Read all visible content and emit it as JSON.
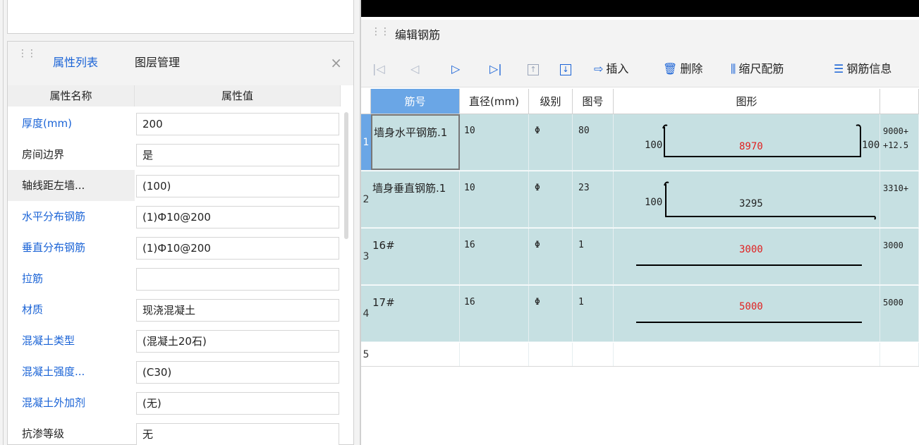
{
  "left_panel": {
    "tabs": [
      "属性列表",
      "图层管理"
    ],
    "close": "×",
    "columns": [
      "属性名称",
      "属性值"
    ],
    "rows": [
      {
        "name": "厚度(mm)",
        "value": "200",
        "blue": true
      },
      {
        "name": "房间边界",
        "value": "是",
        "blue": false
      },
      {
        "name": "轴线距左墙...",
        "value": "(100)",
        "blue": false
      },
      {
        "name": "水平分布钢筋",
        "value": "(1)Ф10@200",
        "blue": true
      },
      {
        "name": "垂直分布钢筋",
        "value": "(1)Ф10@200",
        "blue": true
      },
      {
        "name": "拉筋",
        "value": "",
        "blue": true
      },
      {
        "name": "材质",
        "value": "现浇混凝土",
        "blue": true
      },
      {
        "name": "混凝土类型",
        "value": "(混凝土20石)",
        "blue": true
      },
      {
        "name": "混凝土强度...",
        "value": "(C30)",
        "blue": true
      },
      {
        "name": "混凝土外加剂",
        "value": "(无)",
        "blue": true
      },
      {
        "name": "抗渗等级",
        "value": "无",
        "blue": false
      }
    ]
  },
  "right_panel": {
    "title": "编辑钢筋",
    "toolbar": {
      "insert": "插入",
      "delete": "删除",
      "scale": "缩尺配筋",
      "info": "钢筋信息"
    },
    "columns": [
      "筋号",
      "直径(mm)",
      "级别",
      "图号",
      "图形"
    ],
    "rows": [
      {
        "num": "1",
        "name": "墙身水平钢筋.1",
        "dia": "10",
        "level": "Φ",
        "fig": "80",
        "left": "100",
        "mid": "8970",
        "right": "100",
        "calc1": "9000+",
        "calc2": "+12.5"
      },
      {
        "num": "2",
        "name": "墙身垂直钢筋.1",
        "dia": "10",
        "level": "Φ",
        "fig": "23",
        "left": "100",
        "mid": "3295",
        "right": "",
        "calc1": "3310+",
        "calc2": ""
      },
      {
        "num": "3",
        "name": "16#",
        "dia": "16",
        "level": "Φ",
        "fig": "1",
        "left": "",
        "mid": "3000",
        "right": "",
        "calc1": "3000",
        "calc2": ""
      },
      {
        "num": "4",
        "name": "17#",
        "dia": "16",
        "level": "Φ",
        "fig": "1",
        "left": "",
        "mid": "5000",
        "right": "",
        "calc1": "5000",
        "calc2": ""
      },
      {
        "num": "5",
        "name": "",
        "dia": "",
        "level": "",
        "fig": "",
        "left": "",
        "mid": "",
        "right": "",
        "calc1": "",
        "calc2": ""
      }
    ]
  }
}
